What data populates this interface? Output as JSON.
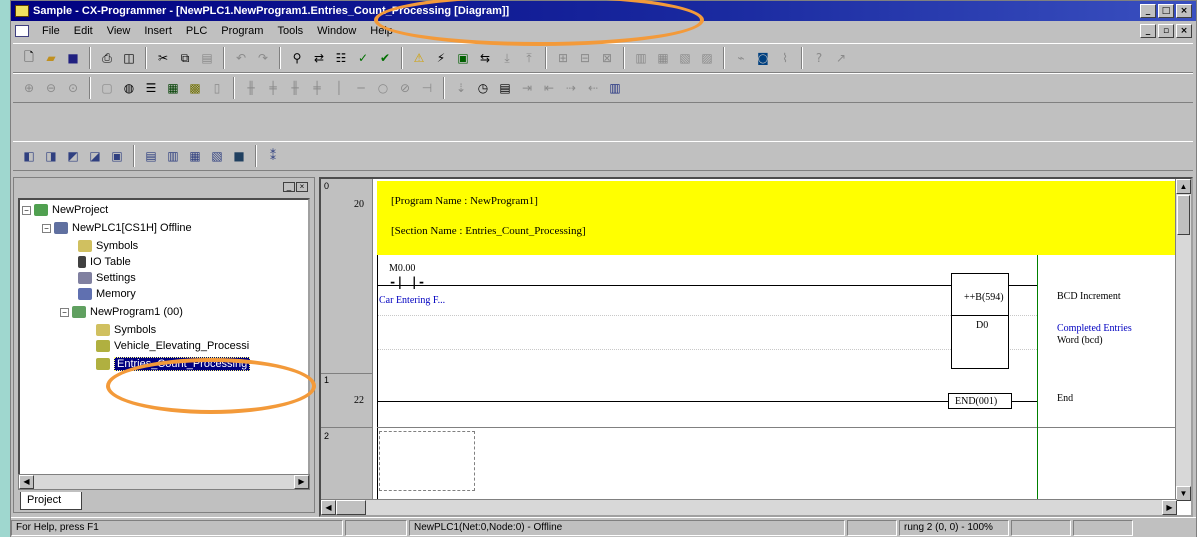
{
  "window": {
    "title": "Sample - CX-Programmer - [NewPLC1.NewProgram1.Entries_Count_Processing [Diagram]]",
    "controls": [
      "_",
      "□",
      "×"
    ],
    "mdi_controls": [
      "_",
      "▫",
      "×"
    ]
  },
  "menu": [
    "File",
    "Edit",
    "View",
    "Insert",
    "PLC",
    "Program",
    "Tools",
    "Window",
    "Help"
  ],
  "project_tree": {
    "items": [
      {
        "label": "NewProject",
        "icon": "project-icon"
      },
      {
        "label": "NewPLC1[CS1H] Offline",
        "icon": "plc-icon"
      },
      {
        "label": "Symbols",
        "icon": "symbols-icon"
      },
      {
        "label": "IO Table",
        "icon": "io-table-icon"
      },
      {
        "label": "Settings",
        "icon": "settings-icon"
      },
      {
        "label": "Memory",
        "icon": "memory-icon"
      },
      {
        "label": "NewProgram1 (00)",
        "icon": "program-icon"
      },
      {
        "label": "Symbols",
        "icon": "symbols-icon"
      },
      {
        "label": "Vehicle_Elevating_Processi",
        "icon": "section-icon"
      },
      {
        "label": "Entries_Count_Processing",
        "icon": "section-icon"
      }
    ],
    "tab": "Project"
  },
  "diagram": {
    "banner_program": "[Program Name : NewProgram1]",
    "banner_section": "[Section Name : Entries_Count_Processing]",
    "rungs": [
      {
        "number": "0",
        "step": "20"
      },
      {
        "number": "1",
        "step": "22"
      },
      {
        "number": "2",
        "step": ""
      }
    ],
    "contact_address": "M0.00",
    "contact_symbol": "-| |-",
    "contact_comment": "Car Entering F...",
    "instruction": "++B(594)",
    "instruction_operand": "D0",
    "instruction_comment": "BCD Increment",
    "operand_comment_1": "Completed Entries",
    "operand_comment_2": "Word (bcd)",
    "end_instruction": "END(001)",
    "end_comment": "End"
  },
  "status": {
    "help": "For Help, press F1",
    "plc": "NewPLC1(Net:0,Node:0) - Offline",
    "position": "rung 2 (0, 0)  - 100%"
  },
  "colors": {
    "highlight": "#f39a3a",
    "banner": "#ffff00",
    "selection": "#000080",
    "title_gradient": "#000080"
  }
}
